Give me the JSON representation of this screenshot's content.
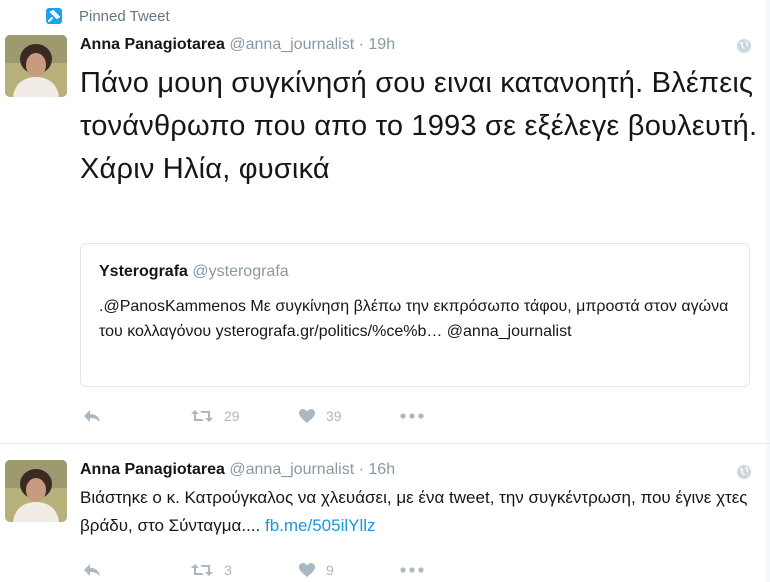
{
  "pinned_label": "Pinned Tweet",
  "tweets": [
    {
      "author_name": "Anna Panagiotarea",
      "author_handle": "@anna_journalist",
      "separator": "·",
      "time": "19h",
      "text": "Πάνο μουη συγκίνησή σου ειναι κατανοητή. Βλέπεις τονάνθρωπο που απο το 1993 σε εξέλεγε βουλευτή. Χάριν Ηλία, φυσικά",
      "quoted": {
        "author_name": "Ysterografa",
        "author_handle": "@ysterografa",
        "text": ".@PanosKammenos Με συγκίνηση βλέπω την εκπρόσωπο τάφου, μπροστά στον αγώνα του κολλαγόνου ysterografa.gr/politics/%ce%b… @anna_journalist"
      },
      "retweets": "29",
      "likes": "39"
    },
    {
      "author_name": "Anna Panagiotarea",
      "author_handle": "@anna_journalist",
      "separator": "·",
      "time": "16h",
      "text": "Βιάστηκε ο κ. Κατρούγκαλος να χλευάσει, με ένα tweet, την συγκέντρωση, που έγινε χτες βράδυ, στο Σύνταγμα.... ",
      "link": "fb.me/505ilYllz",
      "retweets": "3",
      "likes": "9"
    }
  ],
  "colors": {
    "accent": "#1da1f2",
    "link": "#1b95e0",
    "muted": "#8899a6",
    "icon": "#aab8c2"
  },
  "icons": [
    "pin-icon",
    "globe-icon",
    "reply-icon",
    "retweet-icon",
    "like-icon",
    "more-icon"
  ]
}
